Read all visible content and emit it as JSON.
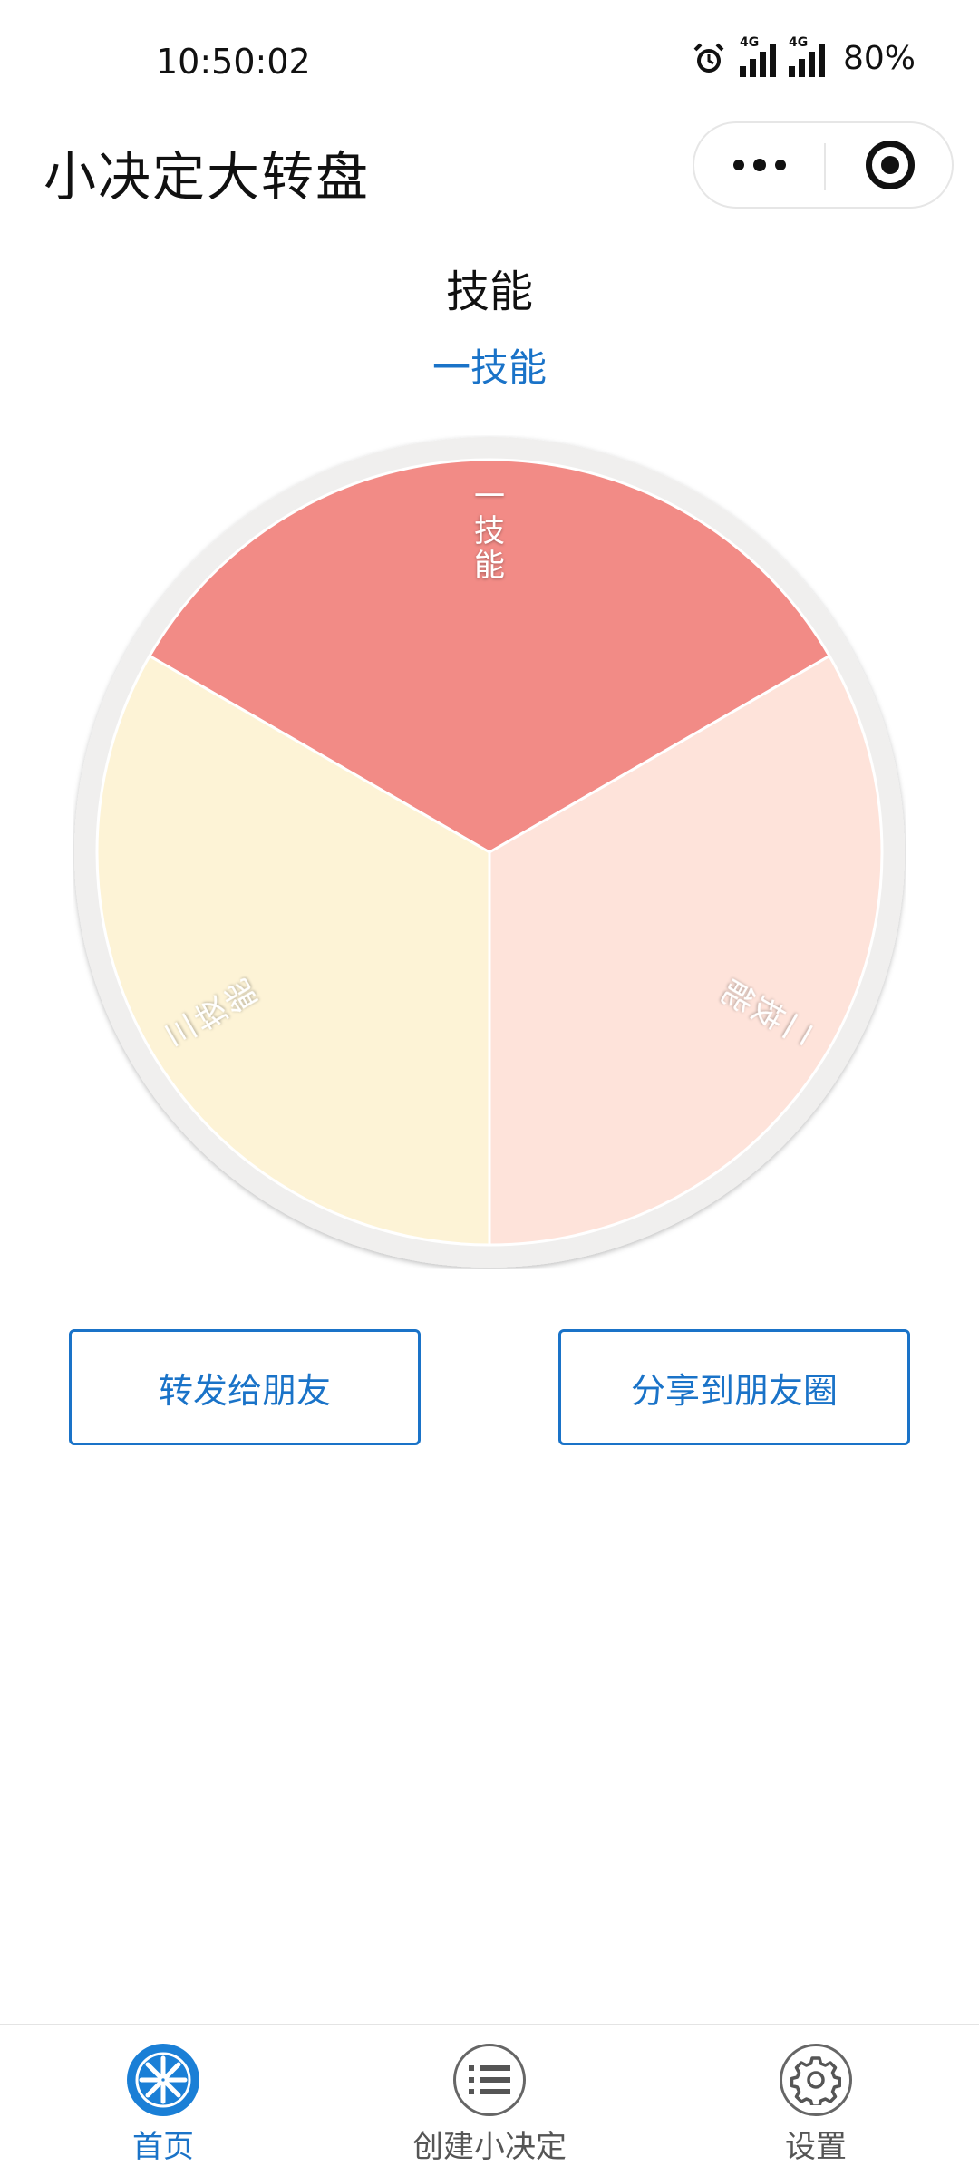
{
  "status_bar": {
    "time": "10:50:02",
    "battery": "80%",
    "network1": "4G",
    "network2": "4G",
    "icons": [
      "alarm-icon",
      "signal-icon",
      "signal-icon"
    ]
  },
  "nav": {
    "title": "小决定大转盘",
    "more_icon": "more-dots-icon",
    "close_icon": "target-close-icon"
  },
  "topic": "技能",
  "result": "一技能",
  "wheel": {
    "segments": [
      {
        "label": "一技能",
        "color": "#f28b86"
      },
      {
        "label": "二技能",
        "color": "#fee3da"
      },
      {
        "label": "三技能",
        "color": "#fdf3d6"
      }
    ],
    "rim_color": "#f0efee"
  },
  "buttons": {
    "forward": "转发给朋友",
    "moments": "分享到朋友圈"
  },
  "tabbar": {
    "items": [
      {
        "label": "首页",
        "icon": "wheel-icon",
        "active": true
      },
      {
        "label": "创建小决定",
        "icon": "list-icon",
        "active": false
      },
      {
        "label": "设置",
        "icon": "gear-icon",
        "active": false
      }
    ]
  },
  "colors": {
    "accent": "#1a73c8",
    "text": "#111111"
  }
}
